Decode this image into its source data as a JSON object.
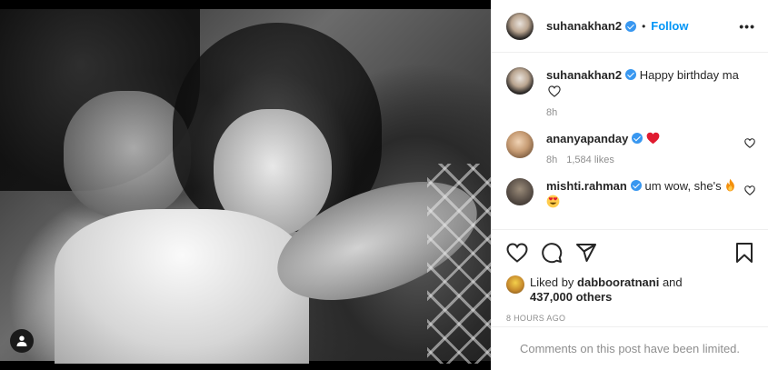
{
  "post": {
    "author": "suhanakhan2",
    "follow_label": "Follow",
    "dot": "•",
    "more_label": "•••"
  },
  "caption": {
    "username": "suhanakhan2",
    "text": "Happy birthday ma",
    "time": "8h"
  },
  "comments": [
    {
      "username": "ananyapanday",
      "text": "",
      "emoji": "red-heart",
      "time": "8h",
      "likes": "1,584 likes"
    },
    {
      "username": "mishti.rahman",
      "text": "um wow, she's",
      "emoji": "fire",
      "emoji2": "heart-eyes"
    }
  ],
  "likes": {
    "prefix": "Liked by",
    "user": "dabbooratnani",
    "and": "and",
    "others": "437,000 others"
  },
  "timestamp": "8 HOURS AGO",
  "comments_limited": "Comments on this post have been limited.",
  "colors": {
    "accent": "#0095f6",
    "verified": "#3897f0",
    "muted": "#8e8e8e",
    "heart_red": "#ed4956"
  },
  "icons": [
    "user-tag-icon",
    "verified-icon",
    "more-icon",
    "heart-icon",
    "comment-icon",
    "share-icon",
    "save-icon",
    "fire-emoji",
    "heart-eyes-emoji",
    "red-heart-emoji"
  ]
}
